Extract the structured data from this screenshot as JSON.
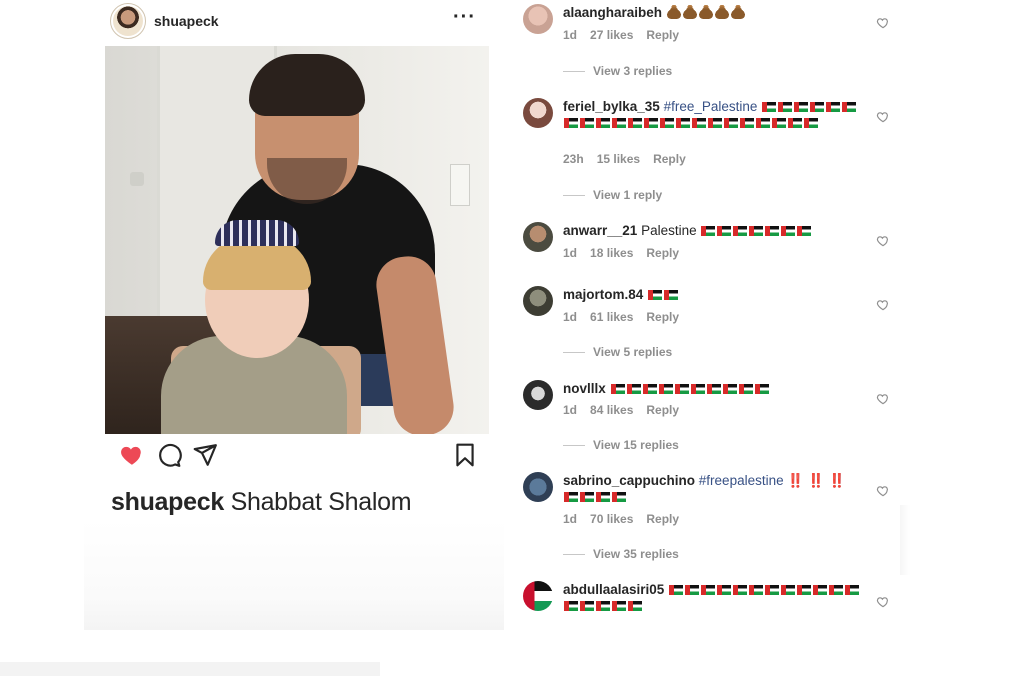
{
  "post": {
    "username": "shuapeck",
    "more_icon": "more-dots-icon",
    "caption_user": "shuapeck",
    "caption_text": "Shabbat Shalom",
    "liked": true,
    "colors": {
      "heart": "#ed4956",
      "text": "#262626"
    }
  },
  "comments": [
    {
      "user": "alaangharaibeh",
      "text": "",
      "emoji": "poo",
      "emoji_count": 5,
      "time": "1d",
      "likes": "27 likes",
      "reply": "Reply",
      "view_replies": "View 3 replies"
    },
    {
      "user": "feriel_bylka_35",
      "text": "#free_Palestine",
      "emoji": "flag",
      "emoji_count": 22,
      "time": "23h",
      "likes": "15 likes",
      "reply": "Reply",
      "view_replies": "View 1 reply"
    },
    {
      "user": "anwarr__21",
      "text": "Palestine",
      "emoji": "flag",
      "emoji_count": 7,
      "time": "1d",
      "likes": "18 likes",
      "reply": "Reply",
      "view_replies": ""
    },
    {
      "user": "majortom.84",
      "text": "",
      "emoji": "flag",
      "emoji_count": 2,
      "time": "1d",
      "likes": "61 likes",
      "reply": "Reply",
      "view_replies": "View 5 replies"
    },
    {
      "user": "novlllx",
      "text": "",
      "emoji": "flag",
      "emoji_count": 10,
      "time": "1d",
      "likes": "84 likes",
      "reply": "Reply",
      "view_replies": "View 15 replies"
    },
    {
      "user": "sabrino_cappuchino",
      "text": "#freepalestine",
      "emoji": "flag",
      "emoji_count": 4,
      "extra": "‼️ ‼️ ‼️",
      "time": "1d",
      "likes": "70 likes",
      "reply": "Reply",
      "view_replies": "View 35 replies"
    },
    {
      "user": "abdullaalasiri05",
      "text": "",
      "emoji": "flag",
      "emoji_count": 17,
      "time": "",
      "likes": "",
      "reply": "",
      "view_replies": ""
    }
  ]
}
